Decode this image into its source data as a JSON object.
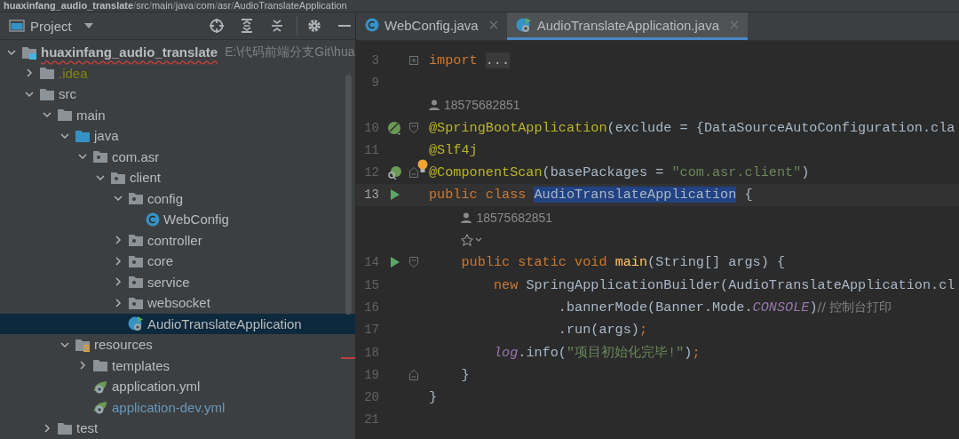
{
  "breadcrumb": [
    {
      "text": "huaxinfang_audio_translate",
      "kind": "item"
    },
    {
      "text": "/",
      "kind": "separator"
    },
    {
      "text": "src",
      "kind": "item"
    },
    {
      "text": "/",
      "kind": "separator"
    },
    {
      "text": "main",
      "kind": "item"
    },
    {
      "text": "/",
      "kind": "separator"
    },
    {
      "text": "java",
      "kind": "item"
    },
    {
      "text": "/",
      "kind": "separator"
    },
    {
      "text": "com",
      "kind": "item"
    },
    {
      "text": "/",
      "kind": "separator"
    },
    {
      "text": "asr",
      "kind": "item"
    },
    {
      "text": "/",
      "kind": "separator"
    },
    {
      "text": "AudioTranslateApplication",
      "kind": "item"
    }
  ],
  "project_panel": {
    "title": "Project",
    "tree": [
      {
        "label": "huaxinfang_audio_translate",
        "kind": "module",
        "expanded": true,
        "misspelled": true,
        "path": "E:\\代码前端分支Git\\hua",
        "children": [
          {
            "label": ".idea",
            "kind": "folder",
            "expanded": false,
            "color": "#848504"
          },
          {
            "label": "src",
            "kind": "folder",
            "expanded": true,
            "children": [
              {
                "label": "main",
                "kind": "folder",
                "expanded": true,
                "children": [
                  {
                    "label": "java",
                    "kind": "source-root",
                    "expanded": true,
                    "children": [
                      {
                        "label": "com.asr",
                        "kind": "package",
                        "expanded": true,
                        "children": [
                          {
                            "label": "client",
                            "kind": "package",
                            "expanded": true,
                            "children": [
                              {
                                "label": "config",
                                "kind": "package",
                                "expanded": true,
                                "children": [
                                  {
                                    "label": "WebConfig",
                                    "kind": "class",
                                    "selected": false
                                  }
                                ]
                              },
                              {
                                "label": "controller",
                                "kind": "package",
                                "expanded": false
                              },
                              {
                                "label": "core",
                                "kind": "package",
                                "expanded": false
                              },
                              {
                                "label": "service",
                                "kind": "package",
                                "expanded": false
                              },
                              {
                                "label": "websocket",
                                "kind": "package",
                                "expanded": false
                              },
                              {
                                "label": "AudioTranslateApplication",
                                "kind": "spring-class",
                                "selected": true
                              }
                            ]
                          }
                        ]
                      }
                    ]
                  },
                  {
                    "label": "resources",
                    "kind": "resources",
                    "expanded": true,
                    "children": [
                      {
                        "label": "templates",
                        "kind": "folder",
                        "expanded": false
                      },
                      {
                        "label": "application.yml",
                        "kind": "yml"
                      },
                      {
                        "label": "application-dev.yml",
                        "kind": "yml",
                        "color": "#6897bb"
                      }
                    ]
                  }
                ]
              },
              {
                "label": "test",
                "kind": "folder",
                "expanded": false
              }
            ]
          }
        ]
      }
    ]
  },
  "editor": {
    "tabs": [
      {
        "label": "WebConfig.java",
        "kind": "class",
        "selected": false
      },
      {
        "label": "AudioTranslateApplication.java",
        "kind": "spring-class",
        "selected": true
      }
    ],
    "lines": [
      {
        "kind": "code",
        "number": "3",
        "fold": {
          "kind": "collapsed"
        },
        "tokens": [
          {
            "text": "import",
            "kind": "keyword"
          },
          {
            "text": "...",
            "kind": "folded"
          }
        ]
      },
      {
        "kind": "code",
        "number": "9"
      },
      {
        "kind": "author",
        "text": "18575682851"
      },
      {
        "kind": "code",
        "number": "10",
        "gutter": {
          "kind": "bean"
        },
        "fold": {
          "kind": "start"
        },
        "tokens": [
          {
            "text": "@SpringBootApplication",
            "kind": "annotation"
          },
          {
            "text": "(exclude = {DataSourceAutoConfiguration.cla",
            "kind": "plain"
          }
        ]
      },
      {
        "kind": "code",
        "number": "11",
        "tokens": [
          {
            "text": "@Slf4j",
            "kind": "annotation"
          }
        ]
      },
      {
        "kind": "code",
        "number": "12",
        "gutter": {
          "kind": "bean-search"
        },
        "fold": {
          "kind": "end"
        },
        "bulb": true,
        "tokens": [
          {
            "text": "@ComponentScan",
            "kind": "annotation"
          },
          {
            "text": "(basePackages = ",
            "kind": "plain"
          },
          {
            "text": "\"com.asr.client\"",
            "kind": "string"
          },
          {
            "text": ")",
            "kind": "plain"
          }
        ]
      },
      {
        "kind": "code",
        "number": "13",
        "gutter": {
          "kind": "run"
        },
        "current": true,
        "tokens": [
          {
            "text": "public class ",
            "kind": "keyword"
          },
          {
            "text": "AudioTranslateApplication",
            "kind": "plain",
            "selected": true
          },
          {
            "text": " {",
            "kind": "plain"
          }
        ]
      },
      {
        "kind": "author",
        "text": "18575682851"
      },
      {
        "kind": "inlay"
      },
      {
        "kind": "code",
        "number": "14",
        "gutter": {
          "kind": "run"
        },
        "fold": {
          "kind": "start"
        },
        "tokens": [
          {
            "text": "    public static void ",
            "kind": "keyword"
          },
          {
            "text": "main",
            "kind": "method"
          },
          {
            "text": "(String[] args) {",
            "kind": "plain"
          }
        ]
      },
      {
        "kind": "code",
        "number": "15",
        "tokens": [
          {
            "text": "        new ",
            "kind": "keyword"
          },
          {
            "text": "SpringApplicationBuilder(AudioTranslateApplication.cl",
            "kind": "plain"
          }
        ]
      },
      {
        "kind": "code",
        "number": "16",
        "tokens": [
          {
            "text": "                .bannerMode(Banner.Mode.",
            "kind": "plain"
          },
          {
            "text": "CONSOLE",
            "kind": "static"
          },
          {
            "text": ")",
            "kind": "plain"
          },
          {
            "text": "// 控制台打印",
            "kind": "comment"
          }
        ]
      },
      {
        "kind": "code",
        "number": "17",
        "tokens": [
          {
            "text": "                .run(args)",
            "kind": "plain"
          },
          {
            "text": ";",
            "kind": "keyword"
          }
        ]
      },
      {
        "kind": "code",
        "number": "18",
        "tokens": [
          {
            "text": "        log",
            "kind": "static"
          },
          {
            "text": ".info(",
            "kind": "plain"
          },
          {
            "text": "\"项目初始化完毕!\"",
            "kind": "string"
          },
          {
            "text": ")",
            "kind": "plain"
          },
          {
            "text": ";",
            "kind": "keyword"
          }
        ]
      },
      {
        "kind": "code",
        "number": "19",
        "fold": {
          "kind": "end"
        },
        "tokens": [
          {
            "text": "    }",
            "kind": "plain"
          }
        ]
      },
      {
        "kind": "code",
        "number": "20",
        "tokens": [
          {
            "text": "}",
            "kind": "plain"
          }
        ]
      },
      {
        "kind": "code",
        "number": "21"
      }
    ]
  }
}
